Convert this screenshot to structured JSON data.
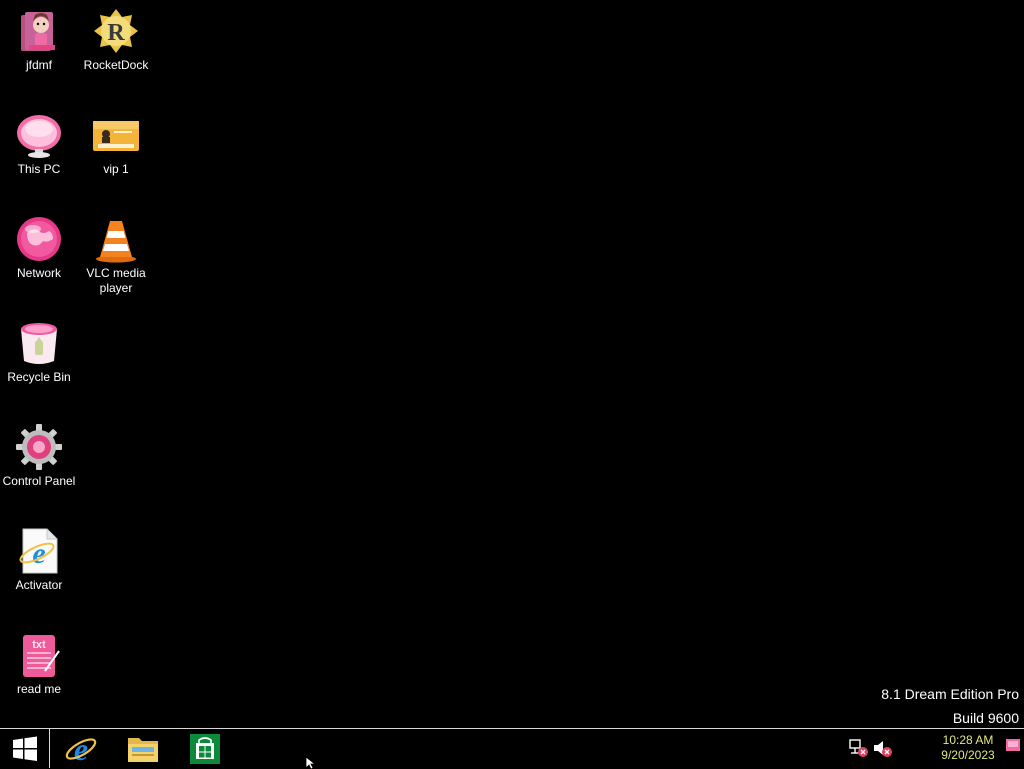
{
  "desktop": {
    "icons": [
      {
        "label": "jfdmf",
        "icon": "doll-folder-icon"
      },
      {
        "label": "RocketDock",
        "icon": "rocketdock-icon"
      },
      {
        "label": "This PC",
        "icon": "this-pc-icon"
      },
      {
        "label": "vip 1",
        "icon": "vip-card-icon"
      },
      {
        "label": "Network",
        "icon": "network-globe-icon"
      },
      {
        "label": "VLC media player",
        "icon": "vlc-cone-icon"
      },
      {
        "label": "Recycle Bin",
        "icon": "recycle-bin-icon"
      },
      {
        "label": "Control Panel",
        "icon": "control-panel-gear-icon"
      },
      {
        "label": "Activator",
        "icon": "internet-explorer-file-icon"
      },
      {
        "label": "read me",
        "icon": "text-notebook-icon"
      }
    ],
    "watermark": {
      "line1": "8.1 Dream Edition Pro",
      "line2": "Build 9600"
    }
  },
  "taskbar": {
    "start": "windows-logo-icon",
    "pinned": [
      {
        "name": "Internet Explorer",
        "icon": "internet-explorer-icon"
      },
      {
        "name": "File Explorer",
        "icon": "file-explorer-icon"
      },
      {
        "name": "Store",
        "icon": "store-icon"
      }
    ],
    "tray": {
      "network_icon": "network-disconnected-icon",
      "volume_icon": "volume-muted-icon",
      "time": "10:28 AM",
      "date": "9/20/2023"
    }
  },
  "colors": {
    "background": "#000000",
    "pink_accent": "#e8508a",
    "clock_text": "#e3e87c"
  }
}
